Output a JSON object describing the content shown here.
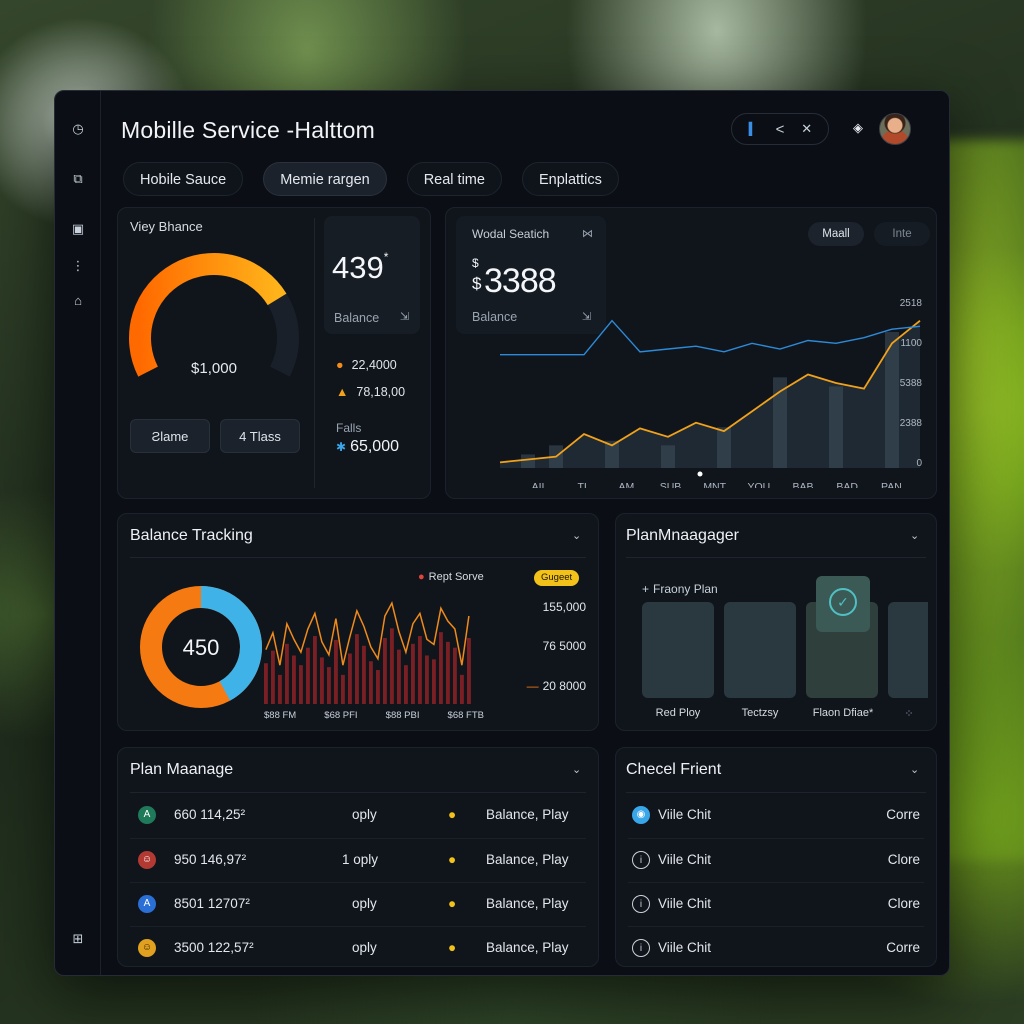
{
  "app": {
    "title": "Mobille Service -Halttom"
  },
  "window_controls": {
    "signal": "▍",
    "back": "<",
    "close": "✕"
  },
  "sidebar": {
    "items": [
      {
        "icon": "clock-icon",
        "glyph": "◷"
      },
      {
        "icon": "chart-icon",
        "glyph": "⧉"
      },
      {
        "icon": "wallet-icon",
        "glyph": "▣"
      },
      {
        "icon": "more-icon",
        "glyph": "⋮"
      },
      {
        "icon": "home-icon",
        "glyph": "⌂"
      },
      {
        "icon": "settings-icon",
        "glyph": "⊞"
      }
    ]
  },
  "tabs": [
    {
      "label": "Hobile Sauce",
      "active": false
    },
    {
      "label": "Memie rargen",
      "active": true
    },
    {
      "label": "Real time",
      "active": false
    },
    {
      "label": "Enplattics",
      "active": false
    }
  ],
  "gauge_card": {
    "label": "Viey Bhance",
    "center_value": "$1,000",
    "gauge_fraction": 0.75,
    "big_value": "439",
    "big_value_sup": "*",
    "balance_label": "Balance",
    "balance_arrow": "⇲",
    "legend": [
      {
        "value": "22,4000",
        "color": "#f28c1a"
      },
      {
        "value": "78,18,00",
        "color": "#f2a21a"
      }
    ],
    "falls_label": "Falls",
    "falls_value": "65,000",
    "btn_left": "Ƨlame",
    "btn_right": "4 Tlass",
    "colors": {
      "start": "#ff6a00",
      "end": "#ffb31a"
    }
  },
  "search_card": {
    "label": "Wodal Seatich",
    "close_glyph": "⋈",
    "value_prefix": "$",
    "value_prefix2": "$",
    "value": "3388",
    "balance_label": "Balance",
    "balance_arrow": "⇲",
    "toggle_a": "Maall",
    "toggle_b": "Inte",
    "chart_data": {
      "type": "line",
      "x": [
        "AII",
        "TI",
        "AM",
        "SUB",
        "MNT",
        "YOU",
        "BAB",
        "BAD",
        "PAN"
      ],
      "y_ticks": [
        "2518",
        "1100",
        "5388",
        "2388",
        "0"
      ],
      "series": [
        {
          "color": "#f2a21a",
          "values": [
            2,
            3,
            4,
            12,
            8,
            14,
            11,
            16,
            13,
            20,
            27,
            33,
            30,
            28,
            44,
            52
          ]
        },
        {
          "color": "#2d8ad8",
          "values": [
            40,
            40,
            40,
            40,
            52,
            41,
            42,
            43,
            41,
            44,
            42,
            45,
            44,
            46,
            49,
            50
          ]
        }
      ],
      "bars": [
        0,
        3,
        5,
        0,
        6,
        0,
        5,
        0,
        9,
        0,
        20,
        0,
        18,
        0,
        30,
        0
      ]
    }
  },
  "balance_tracking": {
    "title": "Balance Tracking",
    "legend_label": "Rept Sorve",
    "badge": "Gugeet",
    "donut_value": "450",
    "donut": {
      "blue": 0.42,
      "orange": 0.58,
      "blue_color": "#3fb3e8",
      "orange_color": "#f57a12"
    },
    "y_labels": [
      "155,000",
      "76 5000",
      "20 8000"
    ],
    "x_labels": [
      "$88 FM",
      "$68 PFI",
      "$88 PBI",
      "$68 FTB"
    ],
    "chart_data": {
      "type": "bar",
      "values": [
        42,
        55,
        30,
        62,
        50,
        40,
        58,
        70,
        48,
        38,
        66,
        30,
        52,
        72,
        60,
        44,
        35,
        68,
        78,
        56,
        40,
        62,
        70,
        50,
        46,
        74,
        64,
        58,
        30,
        68
      ]
    }
  },
  "plan_manager": {
    "title": "PlanMnaagager",
    "subtitle": "Fraony Plan",
    "items": [
      "Red Ploy",
      "Tectzsy",
      "Flaon Dfiae*",
      "⁘"
    ],
    "selected_index": 2
  },
  "plan_manage": {
    "title": "Plan Maanage",
    "rows": [
      {
        "avatar": "A",
        "avatar_color": "#1f7a5a",
        "id": "660 114,25²",
        "mid": "oply",
        "status": "Balance, Play"
      },
      {
        "avatar": "☺",
        "avatar_color": "#b23a32",
        "id": "950 146,97²",
        "mid": "1 oply",
        "status": "Balance, Play"
      },
      {
        "avatar": "A",
        "avatar_color": "#2a6fd6",
        "id": "8501 12707²",
        "mid": "oply",
        "status": "Balance, Play"
      },
      {
        "avatar": "☺",
        "avatar_color": "#e0a020",
        "id": "3500 122,57²",
        "mid": "oply",
        "status": "Balance, Play"
      }
    ]
  },
  "chart_front": {
    "title": "Checel Frient",
    "rows": [
      {
        "label": "Viile Chit",
        "action": "Corre",
        "icon_color": "#3aa6ea",
        "filled": true
      },
      {
        "label": "Viile Chit",
        "action": "Clore",
        "icon_color": "#c9d1da",
        "filled": false
      },
      {
        "label": "Viile Chit",
        "action": "Clore",
        "icon_color": "#c9d1da",
        "filled": false
      },
      {
        "label": "Viile Chit",
        "action": "Corre",
        "icon_color": "#c9d1da",
        "filled": false
      }
    ]
  }
}
